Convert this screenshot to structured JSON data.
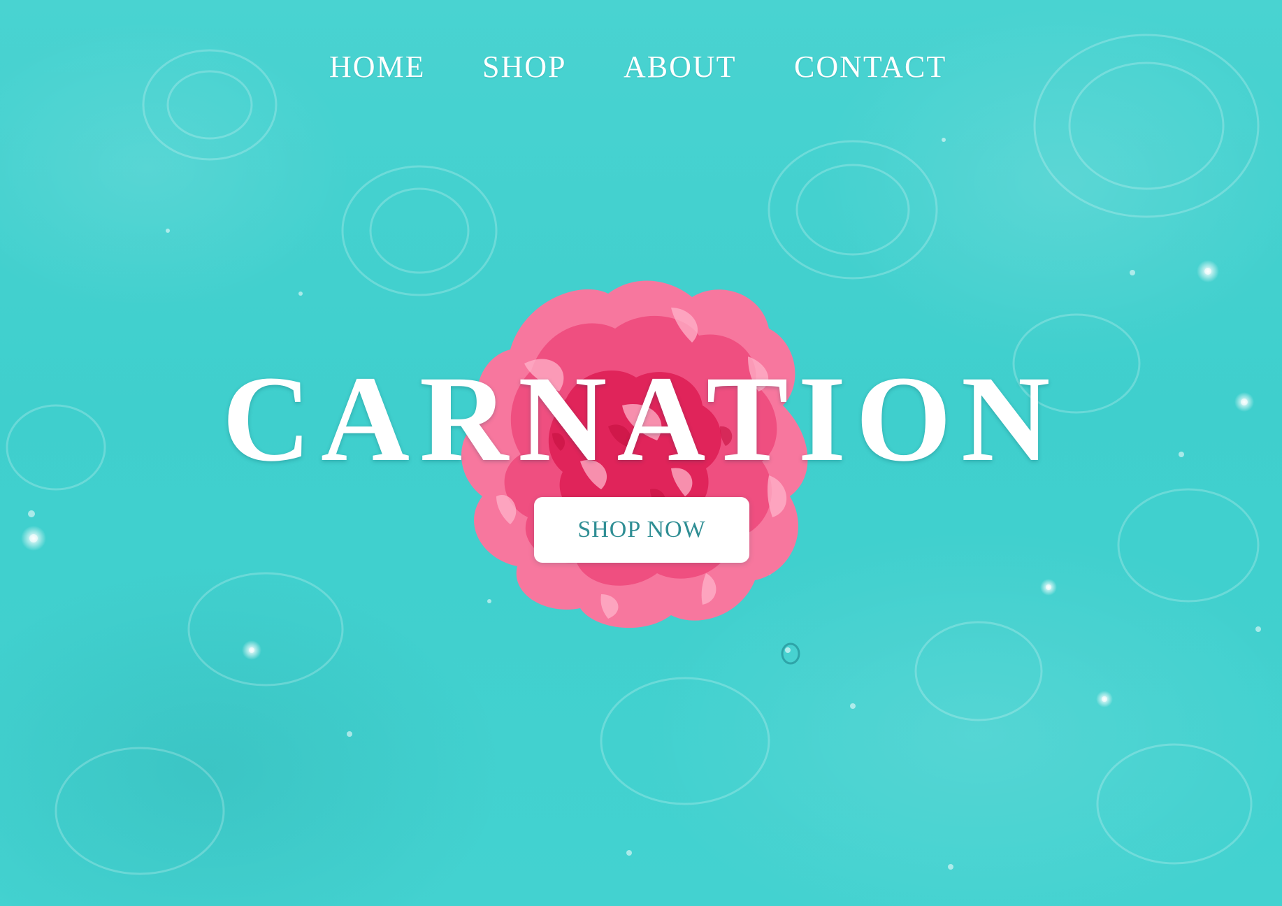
{
  "nav": {
    "items": [
      {
        "label": "HOME"
      },
      {
        "label": "SHOP"
      },
      {
        "label": "ABOUT"
      },
      {
        "label": "CONTACT"
      }
    ]
  },
  "hero": {
    "title": "CARNATION",
    "cta_label": "SHOP NOW"
  },
  "colors": {
    "background": "#3fd0cf",
    "text": "#ffffff",
    "button_bg": "#ffffff",
    "button_text": "#2f8e94",
    "flower_pink": "#f25a8c",
    "flower_red": "#e02455"
  },
  "imagery": {
    "background": "water-ripples",
    "centerpiece": "pink-carnation-flower"
  }
}
